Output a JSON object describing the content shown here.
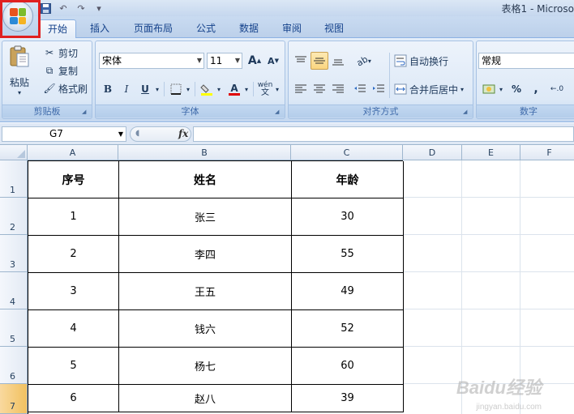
{
  "title_bar": {
    "title": "表格1 - Microso"
  },
  "tabs": [
    {
      "label": "开始",
      "active": true
    },
    {
      "label": "插入"
    },
    {
      "label": "页面布局"
    },
    {
      "label": "公式"
    },
    {
      "label": "数据"
    },
    {
      "label": "审阅"
    },
    {
      "label": "视图"
    }
  ],
  "ribbon": {
    "clipboard": {
      "paste": "粘贴",
      "cut": "剪切",
      "copy": "复制",
      "format_painter": "格式刷",
      "label": "剪贴板"
    },
    "font": {
      "font_name": "宋体",
      "font_size": "11",
      "grow": "A",
      "shrink": "A",
      "bold": "B",
      "italic": "I",
      "underline": "U",
      "font_color_letter": "A",
      "phonetic": "wén",
      "label": "字体"
    },
    "alignment": {
      "wrap_text": "自动换行",
      "merge_center": "合并后居中",
      "label": "对齐方式"
    },
    "number": {
      "format": "常规",
      "percent": "%",
      "comma": ",",
      "label": "数字"
    }
  },
  "formula_bar": {
    "name_box": "G7",
    "fx": "fx",
    "formula": ""
  },
  "sheet": {
    "columns": [
      "A",
      "B",
      "C",
      "D",
      "E",
      "F"
    ],
    "rows": [
      "1",
      "2",
      "3",
      "4",
      "5",
      "6",
      "7"
    ],
    "selected_row": "7",
    "table": {
      "headers": [
        "序号",
        "姓名",
        "年龄"
      ],
      "rows": [
        [
          "1",
          "张三",
          "30"
        ],
        [
          "2",
          "李四",
          "55"
        ],
        [
          "3",
          "王五",
          "49"
        ],
        [
          "4",
          "钱六",
          "52"
        ],
        [
          "5",
          "杨七",
          "60"
        ],
        [
          "6",
          "赵八",
          "39"
        ]
      ]
    }
  },
  "watermark": {
    "brand": "Baidu经验",
    "url": "jingyan.baidu.com"
  },
  "colors": {
    "highlight_frame": "#e02020",
    "selected_row_header": "#f1c15f",
    "ribbon_accent": "#15428b"
  }
}
